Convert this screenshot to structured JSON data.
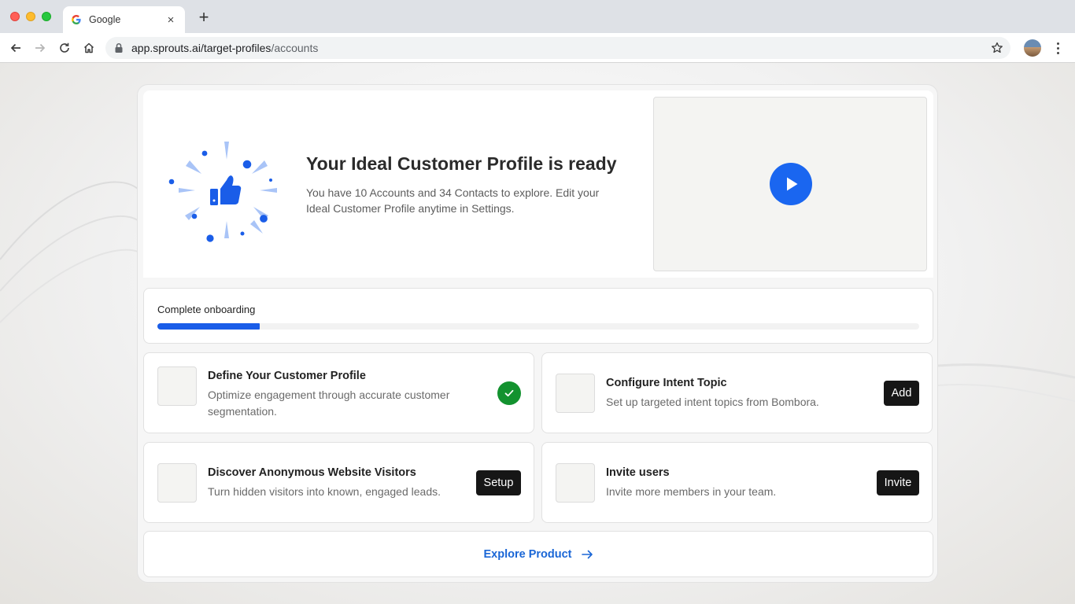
{
  "browser": {
    "tab": {
      "title": "Google",
      "close_glyph": "×",
      "favicon": "google-favicon-icon"
    },
    "new_tab_glyph": "+",
    "address": {
      "host": "app.sprouts.ai/target-profiles",
      "path": "/accounts"
    }
  },
  "hero": {
    "title": "Your Ideal Customer Profile is ready",
    "description": "You have 10 Accounts and 34 Contacts to explore. Edit your Ideal Customer Profile anytime in Settings.",
    "illustration_icon": "thumbs-up-icon",
    "video_icon": "play-icon"
  },
  "onboarding": {
    "label": "Complete onboarding",
    "progress_fraction": 0.134
  },
  "tasks": [
    {
      "title": "Define Your Customer Profile",
      "description": "Optimize engagement through accurate customer segmentation.",
      "status": "completed"
    },
    {
      "title": "Configure Intent Topic",
      "description": "Set up targeted intent topics from Bombora.",
      "button": "Add"
    },
    {
      "title": "Discover Anonymous Website Visitors",
      "description": "Turn hidden visitors into known, engaged leads.",
      "button": "Setup"
    },
    {
      "title": "Invite users",
      "description": "Invite more members in your team.",
      "button": "Invite"
    }
  ],
  "explore": {
    "label": "Explore Product",
    "icon": "arrow-right-icon"
  },
  "colors": {
    "accent": "#1a66f0",
    "progress": "#1a5de8",
    "success": "#13922f",
    "button_dark": "#161616",
    "link": "#1a66d6"
  }
}
